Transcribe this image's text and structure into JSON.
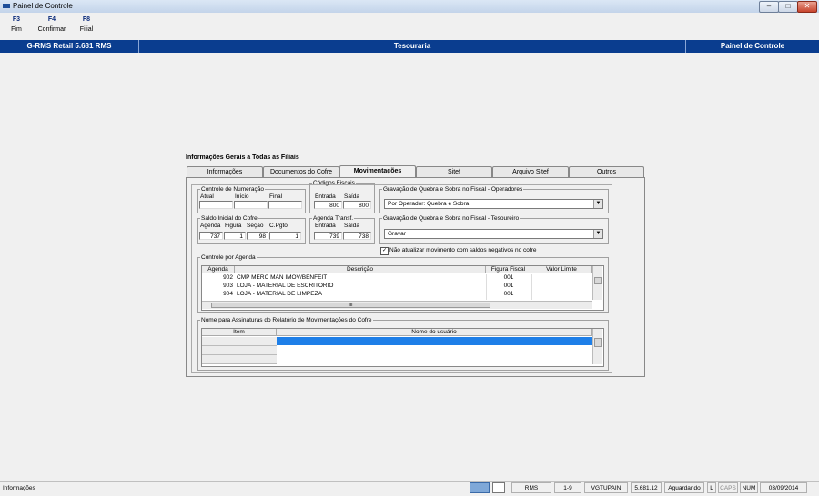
{
  "window": {
    "title": "Painel de Controle",
    "controls": [
      "minimize-icon",
      "maximize-icon",
      "close-icon"
    ]
  },
  "toolbar": [
    {
      "key": "F3",
      "label": "Fim"
    },
    {
      "key": "F4",
      "label": "Confirmar"
    },
    {
      "key": "F8",
      "label": "Filial"
    }
  ],
  "header": {
    "left": "G-RMS Retail 5.681 RMS",
    "center": "Tesouraria",
    "right": "Painel de Controle"
  },
  "group": {
    "title": "Informações Gerais a Todas as Filiais"
  },
  "tabs": [
    "Informações",
    "Documentos do Cofre",
    "Movimentações",
    "Sitef",
    "Arquivo  Sitef",
    "Outros"
  ],
  "controle_numeracao": {
    "legend": "Controle de Numeração",
    "labels": [
      "Atual",
      "Início",
      "Final"
    ],
    "values": [
      "",
      "",
      ""
    ]
  },
  "codigos_fiscais": {
    "legend": "Códigos Fiscais",
    "labels": [
      "Entrada",
      "Saída"
    ],
    "values": [
      "800",
      "800"
    ]
  },
  "saldo_inicial": {
    "legend": "Saldo Inicial do Cofre",
    "labels": [
      "Agenda",
      "Figura",
      "Seção",
      "C.Pgto"
    ],
    "values": [
      "737",
      "1",
      "98",
      "1"
    ]
  },
  "agenda_transf": {
    "legend": "Agenda Transf.",
    "labels": [
      "Entrada",
      "Saída"
    ],
    "values": [
      "739",
      "738"
    ]
  },
  "grav_operadores": {
    "legend": "Gravação de Quebra e Sobra no Fiscal - Operadores",
    "value": "Por Operador: Quebra e Sobra"
  },
  "grav_tesoureiro": {
    "legend": "Gravação de Quebra e Sobra no Fiscal - Tesoureiro",
    "value": "Gravar"
  },
  "checkbox": {
    "label": "Não atualizar movimento com saldos negativos no cofre",
    "checked": true
  },
  "controle_agenda": {
    "legend": "Controle por Agenda",
    "columns": [
      "Agenda",
      "Descrição",
      "Figura Fiscal",
      "Valor Limite"
    ],
    "rows": [
      {
        "agenda": "902",
        "descricao": "CMP MERC MAN IMOV/BENFEIT",
        "figura": "001",
        "valor": ""
      },
      {
        "agenda": "903",
        "descricao": "LOJA - MATERIAL DE ESCRITORIO",
        "figura": "001",
        "valor": ""
      },
      {
        "agenda": "904",
        "descricao": "LOJA - MATERIAL DE LIMPEZA",
        "figura": "001",
        "valor": ""
      }
    ],
    "hscroll_thumb": "III"
  },
  "assinaturas": {
    "legend": "Nome para Assinaturas do Relatório de Movimentações do Cofre",
    "columns": [
      "Item",
      "Nome do usuário"
    ]
  },
  "status": {
    "left": "Informações",
    "panels": [
      "RMS",
      "1-9",
      "VGTUPAIN",
      "5.681.12",
      "Aguardando",
      "L",
      "CAPS",
      "NUM",
      "03/09/2014"
    ]
  },
  "colors": {
    "header_bg": "#0a3d8f",
    "selection": "#1e7fe8"
  }
}
